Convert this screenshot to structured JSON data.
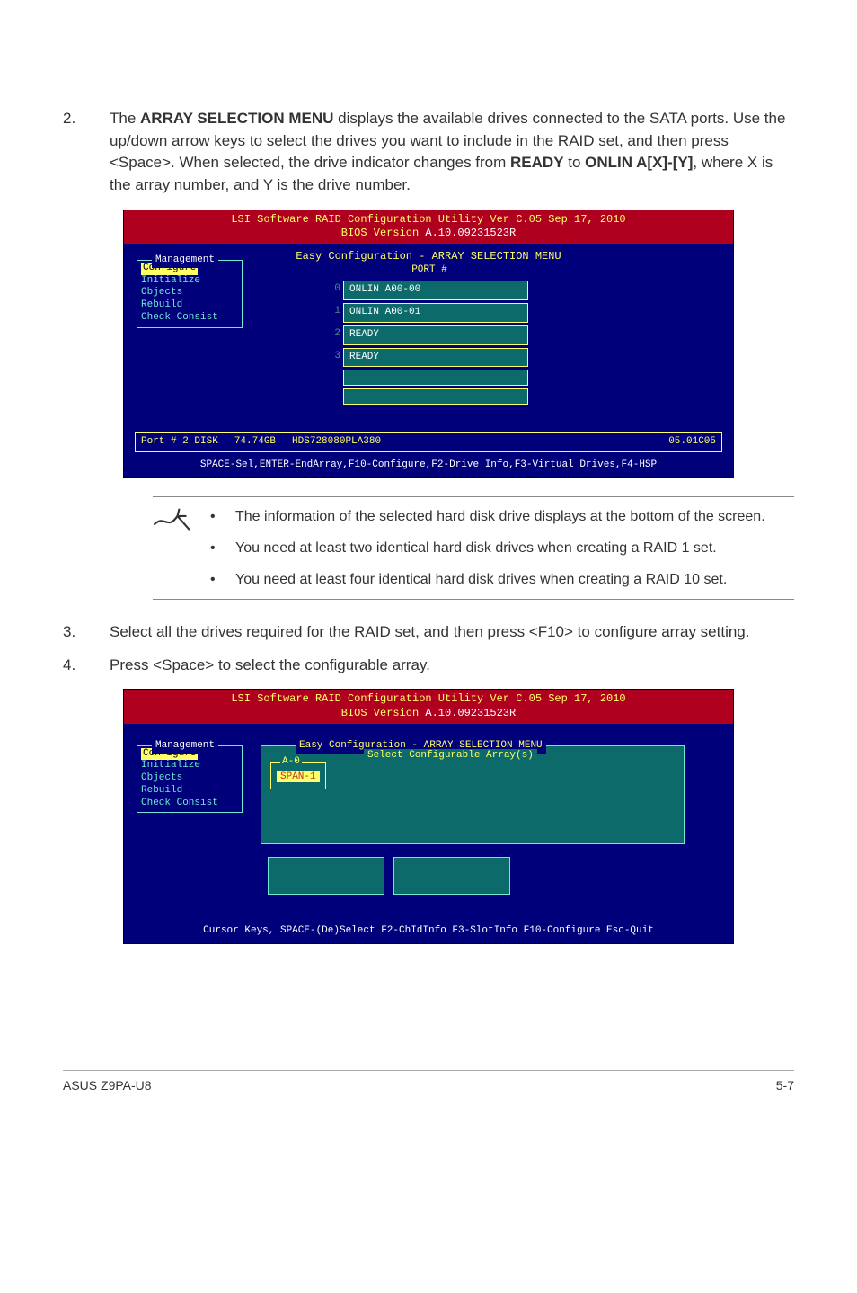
{
  "steps": {
    "s2": {
      "num": "2.",
      "pre": "The ",
      "bold1": "ARRAY SELECTION MENU",
      "mid1": " displays the available drives connected to the SATA ports. Use the up/down arrow keys to select the drives you want to include in the RAID set, and then press <Space>. When selected, the drive indicator changes from ",
      "bold2": "READY",
      "mid2": " to ",
      "bold3": "ONLIN A[X]-[Y]",
      "tail": ", where X is the array number, and Y is the drive number."
    },
    "s3": {
      "num": "3.",
      "text": "Select all the drives required for the RAID set, and then press <F10> to configure array setting."
    },
    "s4": {
      "num": "4.",
      "text": "Press <Space> to select the configurable array."
    }
  },
  "bios": {
    "title1": "LSI Software RAID Configuration Utility Ver C.05 Sep 17, 2010",
    "title2a": "BIOS Version   ",
    "title2b": "A.10.09231523R",
    "easy_title": "Easy Configuration - ARRAY SELECTION MENU",
    "mgmt_title": "Management",
    "mgmt": {
      "configure": "Configure",
      "initialize": "Initialize",
      "objects": "Objects",
      "rebuild": "Rebuild",
      "check": "Check Consist"
    },
    "port_header": "PORT #",
    "ports": [
      {
        "idx": "0",
        "label": "ONLIN A00-00"
      },
      {
        "idx": "1",
        "label": "ONLIN A00-01"
      },
      {
        "idx": "2",
        "label": "READY"
      },
      {
        "idx": "3",
        "label": "READY"
      }
    ],
    "disk": {
      "port": "Port # 2 DISK",
      "size": "74.74GB",
      "model": "HDS728080PLA380",
      "rev": "05.01C05"
    },
    "help1": "SPACE-Sel,ENTER-EndArray,F10-Configure,F2-Drive Info,F3-Virtual Drives,F4-HSP",
    "easy_title2": "Easy Configuration - ARRAY SELECTION MENU",
    "select_cfg": "Select Configurable Array(s)",
    "a0": "A-0",
    "span": "SPAN-1",
    "help2": "Cursor Keys, SPACE-(De)Select F2-ChIdInfo F3-SlotInfo F10-Configure Esc-Quit"
  },
  "notes": {
    "n1": "The information of the selected hard disk drive displays at the bottom of the screen.",
    "n2": "You need at least two identical hard disk drives when creating a RAID 1 set.",
    "n3": "You need at least four identical hard disk drives when creating a RAID 10 set."
  },
  "footer": {
    "left": "ASUS Z9PA-U8",
    "right": "5-7"
  }
}
